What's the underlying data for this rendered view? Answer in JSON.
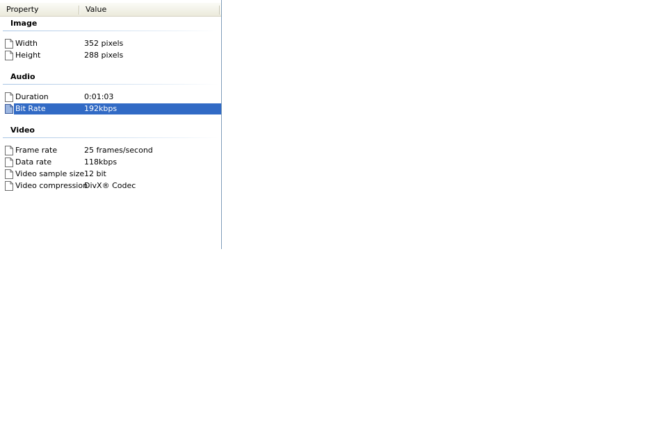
{
  "columns": {
    "property": "Property",
    "value": "Value"
  },
  "groups": [
    {
      "title": "Image",
      "rows": [
        {
          "name": "Width",
          "value": "352 pixels"
        },
        {
          "name": "Height",
          "value": "288 pixels"
        }
      ]
    },
    {
      "title": "Audio",
      "rows": [
        {
          "name": "Duration",
          "value": "0:01:03"
        },
        {
          "name": "Bit Rate",
          "value": "192kbps",
          "selected": true
        }
      ]
    },
    {
      "title": "Video",
      "rows": [
        {
          "name": "Frame rate",
          "value": "25 frames/second"
        },
        {
          "name": "Data rate",
          "value": "118kbps"
        },
        {
          "name": "Video sample size",
          "value": "12 bit"
        },
        {
          "name": "Video compression",
          "value": "DivX® Codec"
        }
      ]
    }
  ],
  "colors": {
    "selection": "#316ac5",
    "selection_text": "#ffffff",
    "group_line": "#a7c4e4",
    "header_bg": "#ebeadb"
  },
  "icons": {
    "row_icon": "document-icon"
  }
}
